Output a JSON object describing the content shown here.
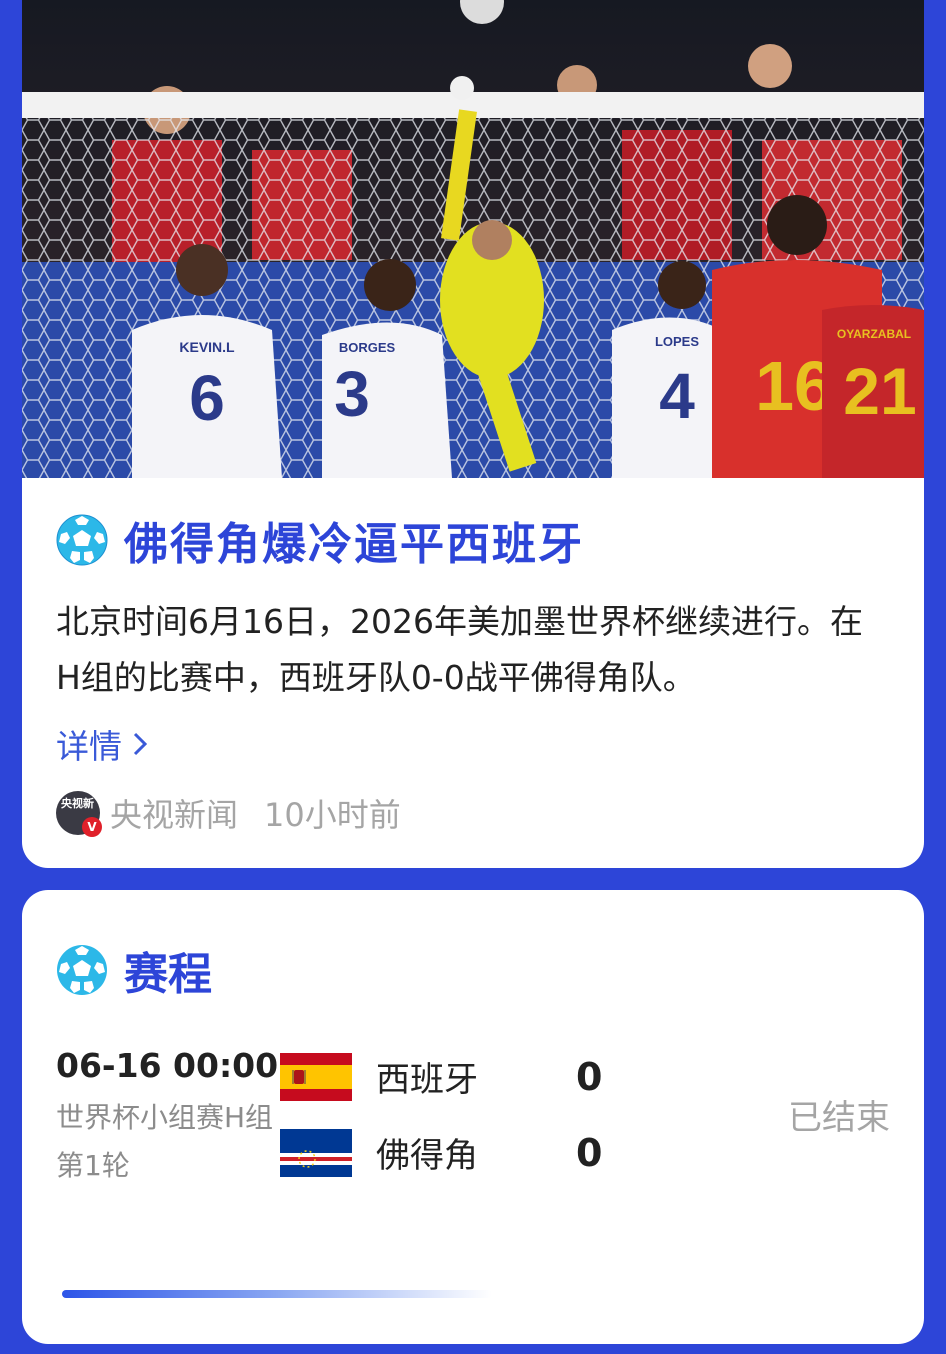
{
  "news": {
    "title": "佛得角爆冷逼平西班牙",
    "summary": "北京时间6月16日，2026年美加墨世界杯继续进行。在H组的比赛中，西班牙队0-0战平佛得角队。",
    "detail_label": "详情",
    "source_logo_text": "央视新",
    "source_logo_badge": "V",
    "source": "央视新闻",
    "time_ago": "10小时前",
    "photo": {
      "jersey_players": [
        {
          "name": "KEVIN.L",
          "number": "6"
        },
        {
          "name": "BORGES",
          "number": "3"
        },
        {
          "name": "LOPES",
          "number": "4"
        },
        {
          "name": "",
          "number": "16"
        },
        {
          "name": "OYARZABAL",
          "number": "21"
        }
      ]
    }
  },
  "schedule": {
    "title": "赛程",
    "match": {
      "datetime": "06-16 00:00",
      "stage": "世界杯小组赛H组第1轮",
      "home": {
        "name": "西班牙",
        "score": "0"
      },
      "away": {
        "name": "佛得角",
        "score": "0"
      },
      "status": "已结束"
    }
  },
  "colors": {
    "background": "#2d45d8",
    "title_blue": "#2d45d8",
    "link_blue": "#3a5ad8",
    "muted": "#a5a5a5"
  },
  "icons": [
    "soccer-ball-icon",
    "chevron-right-icon",
    "spain-flag-icon",
    "cape-verde-flag-icon"
  ]
}
